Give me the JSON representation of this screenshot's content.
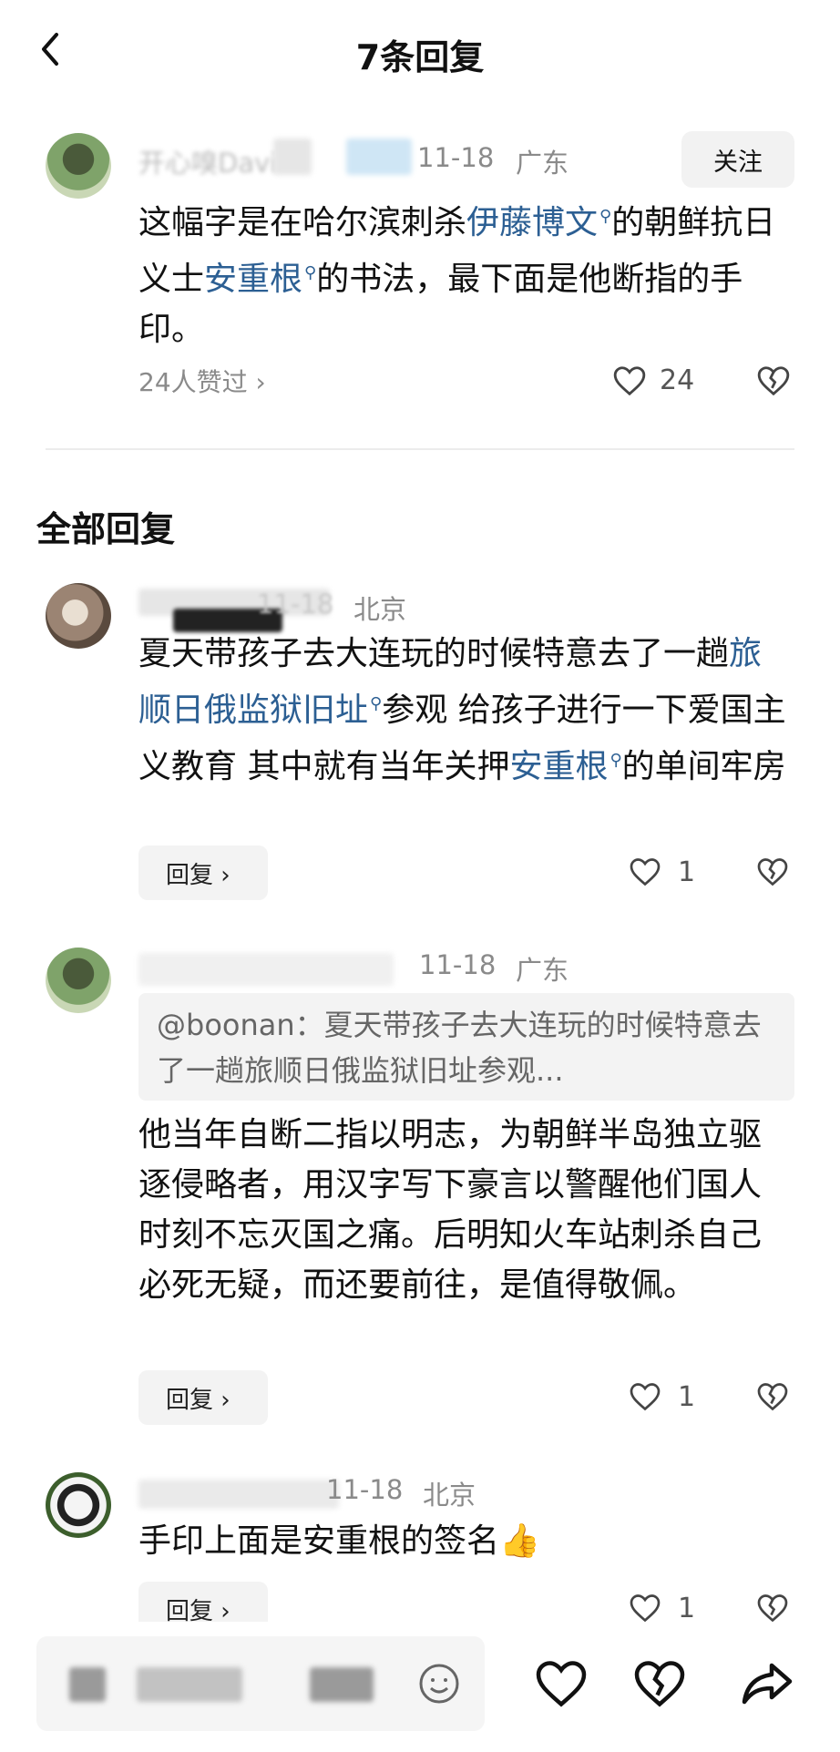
{
  "header": {
    "title": "7条回复"
  },
  "main_comment": {
    "username": "开心嗅Davi",
    "date": "11-18",
    "location": "广东",
    "follow_label": "关注",
    "text_parts": [
      "这幅字是在哈尔滨刺杀",
      "伊藤博文",
      "的朝鲜抗日义士",
      "安重根",
      "的书法，最下面是他断指的手印。"
    ],
    "likes_summary": "24人赞过",
    "like_count": "24"
  },
  "section_title": "全部回复",
  "replies": [
    {
      "date": "11-18",
      "location": "北京",
      "text_parts": [
        "夏天带孩子去大连玩的时候特意去了一趟",
        "旅顺日俄监狱旧址",
        "参观 给孩子进行一下爱国主义教育 其中就有当年关押",
        "安重根",
        "的单间牢房"
      ],
      "reply_label": "回复",
      "like_count": "1"
    },
    {
      "date": "11-18",
      "location": "广东",
      "quote": "@boonan：夏天带孩子去大连玩的时候特意去了一趟旅顺日俄监狱旧址参观...",
      "text": "他当年自断二指以明志，为朝鲜半岛独立驱逐侵略者，用汉字写下豪言以警醒他们国人时刻不忘灭国之痛。后明知火车站刺杀自己必死无疑，而还要前往，是值得敬佩。",
      "reply_label": "回复",
      "like_count": "1"
    },
    {
      "date": "11-18",
      "location": "北京",
      "text": "手印上面是安重根的签名",
      "reply_label": "回复",
      "like_count": "1"
    }
  ],
  "icons": {
    "back": "chevron-left-icon",
    "like": "heart-icon",
    "dislike": "broken-heart-icon",
    "emoji": "smiley-icon",
    "share": "share-arrow-icon",
    "thumbs_up": "thumbs-up-emoji"
  },
  "colors": {
    "link": "#2c5f93",
    "meta": "#8a8a8a"
  }
}
